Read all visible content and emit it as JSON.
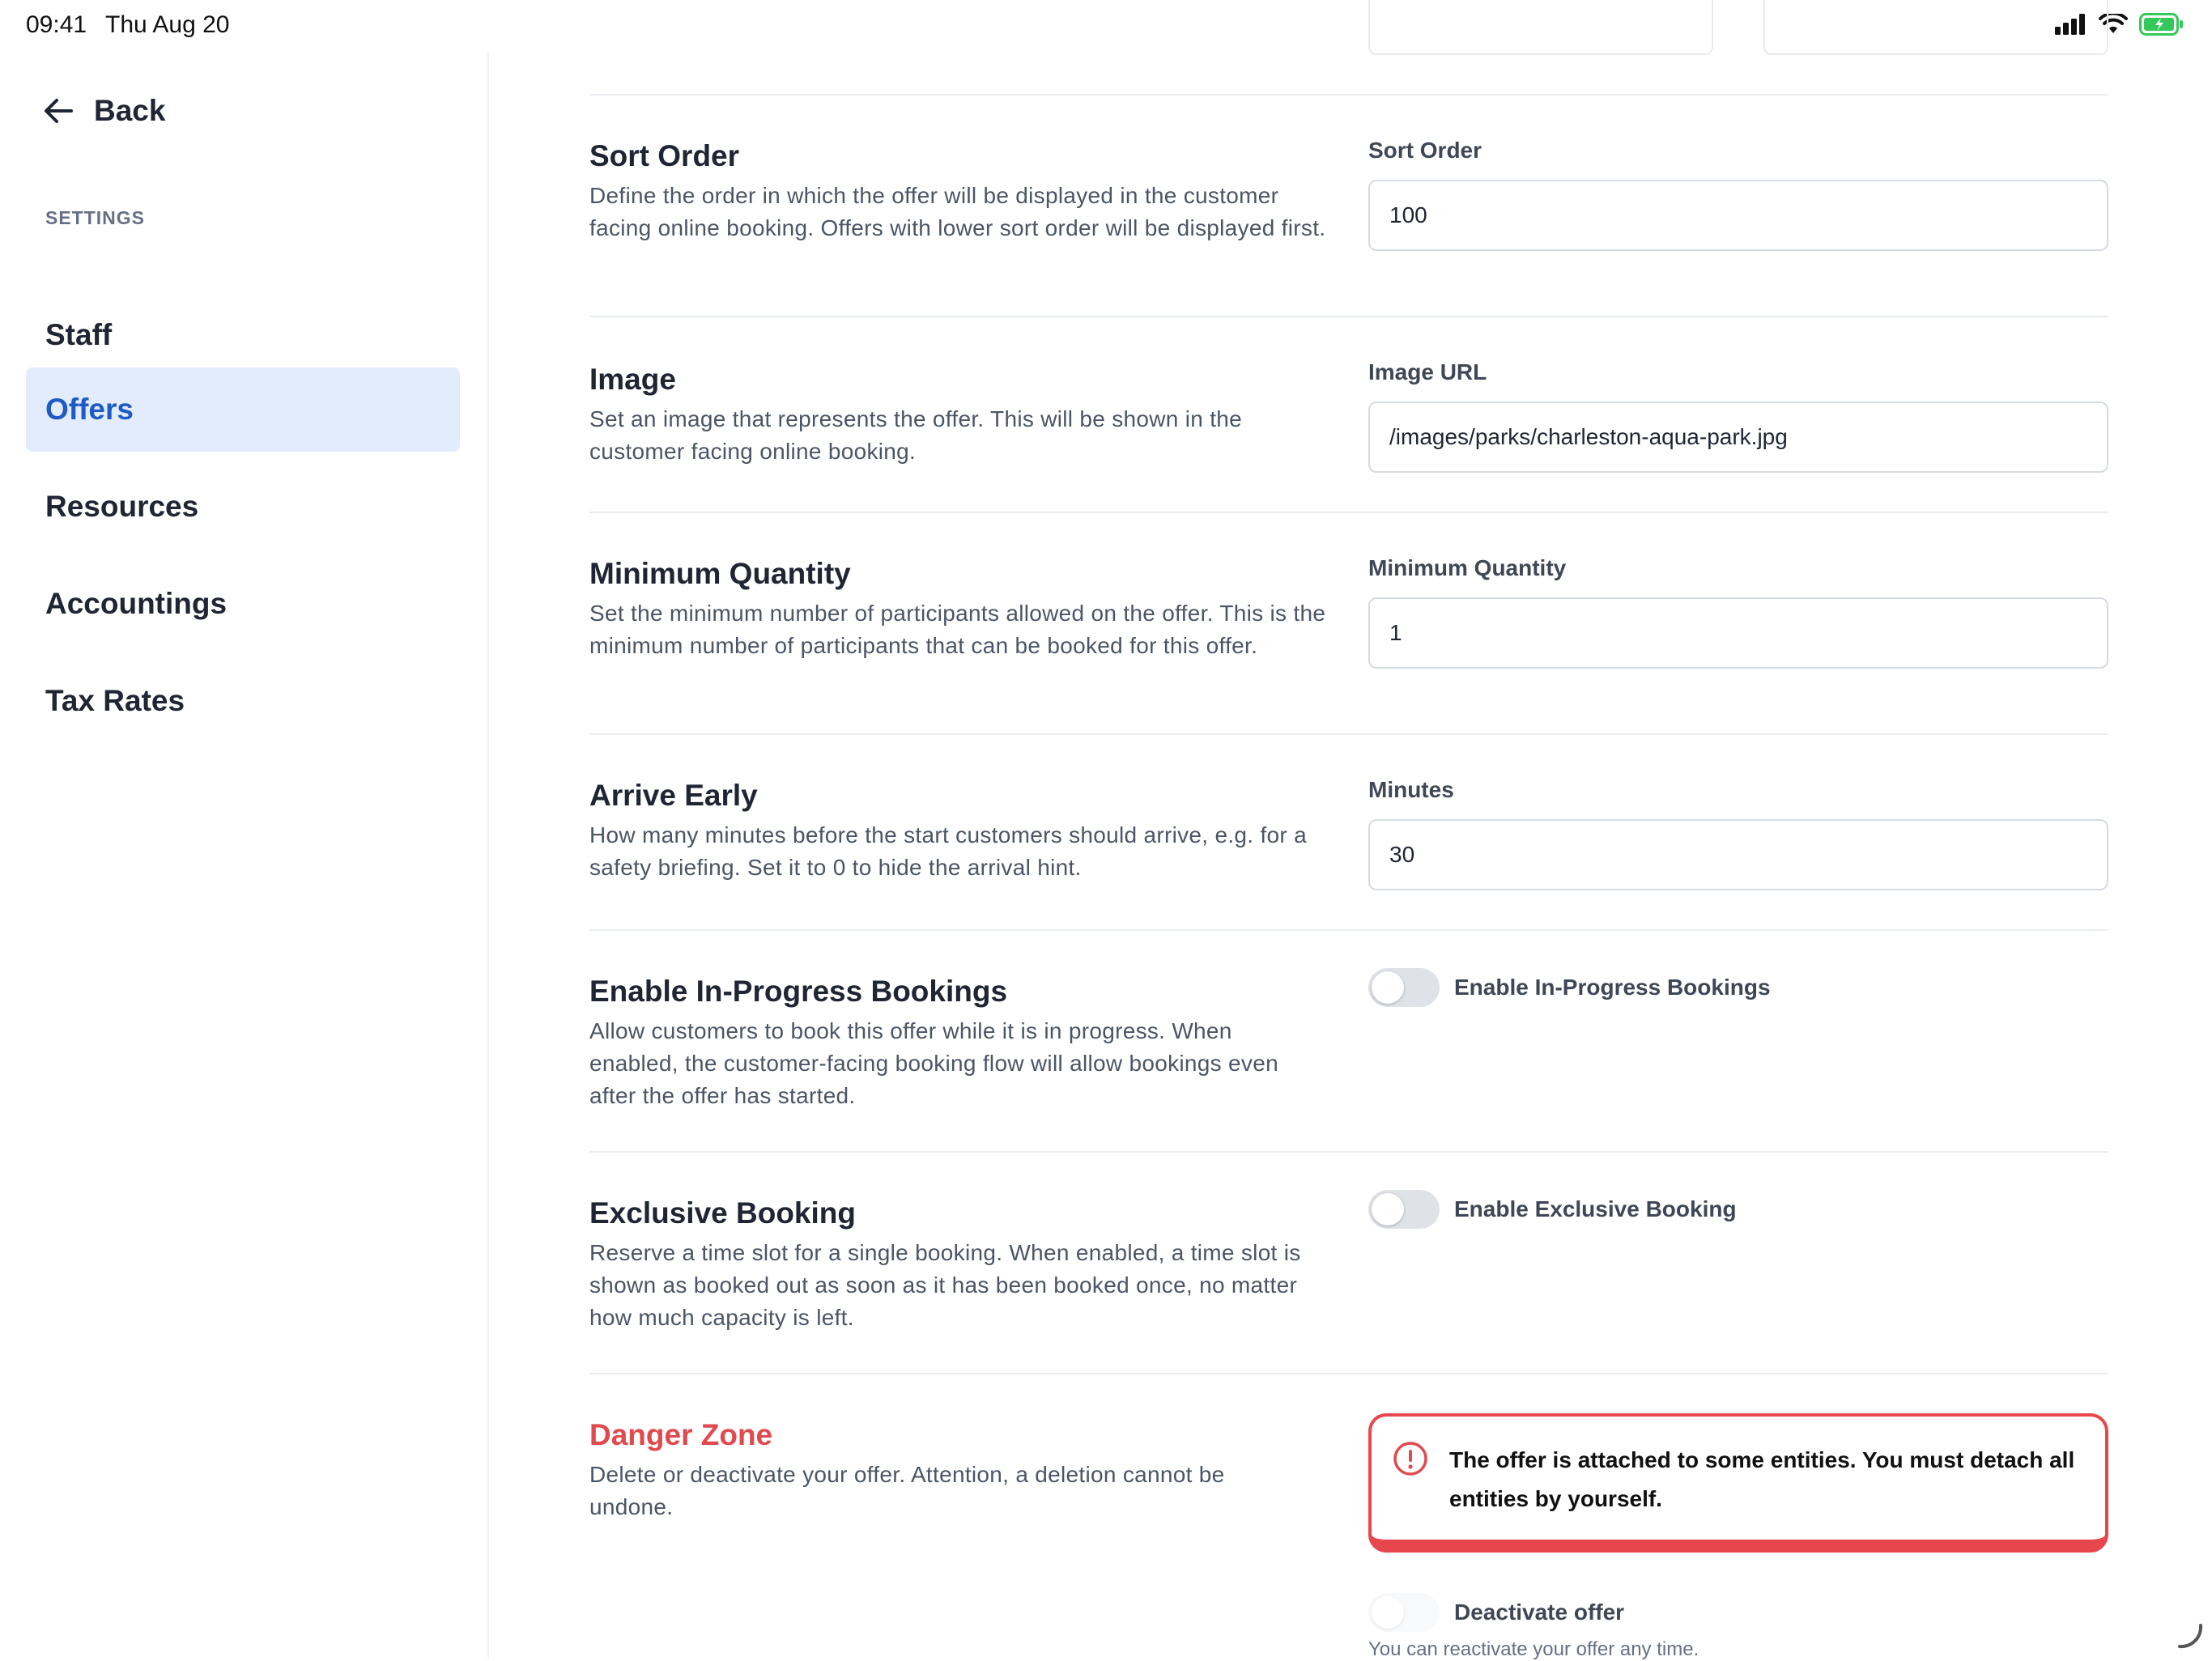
{
  "status_bar": {
    "time": "09:41",
    "date": "Thu Aug 20"
  },
  "sidebar": {
    "back_label": "Back",
    "section_label": "SETTINGS",
    "items": [
      {
        "label": "Staff",
        "active": false
      },
      {
        "label": "Offers",
        "active": true
      },
      {
        "label": "Resources",
        "active": false
      },
      {
        "label": "Accountings",
        "active": false
      },
      {
        "label": "Tax Rates",
        "active": false
      }
    ]
  },
  "sections": {
    "sort_order": {
      "title": "Sort Order",
      "description": "Define the order in which the offer will be displayed in the customer facing online booking. Offers with lower sort order will be displayed first.",
      "field_label": "Sort Order",
      "value": "100"
    },
    "image": {
      "title": "Image",
      "description": "Set an image that represents the offer. This will be shown in the customer facing online booking.",
      "field_label": "Image URL",
      "value": "/images/parks/charleston-aqua-park.jpg"
    },
    "minimum_quantity": {
      "title": "Minimum Quantity",
      "description": "Set the minimum number of participants allowed on the offer. This is the minimum number of participants that can be booked for this offer.",
      "field_label": "Minimum Quantity",
      "value": "1"
    },
    "arrive_early": {
      "title": "Arrive Early",
      "description": "How many minutes before the start customers should arrive, e.g. for a safety briefing. Set it to 0 to hide the arrival hint.",
      "field_label": "Minutes",
      "value": "30"
    },
    "in_progress": {
      "title": "Enable In-Progress Bookings",
      "description": "Allow customers to book this offer while it is in progress. When enabled, the customer-facing booking flow will allow bookings even after the offer has started.",
      "toggle_label": "Enable In-Progress Bookings",
      "enabled": false
    },
    "exclusive": {
      "title": "Exclusive Booking",
      "description": "Reserve a time slot for a single booking. When enabled, a time slot is shown as booked out as soon as it has been booked once, no matter how much capacity is left.",
      "toggle_label": "Enable Exclusive Booking",
      "enabled": false
    },
    "danger_zone": {
      "title": "Danger Zone",
      "description": "Delete or deactivate your offer. Attention, a deletion cannot be undone.",
      "alert_text": "The offer is attached to some entities. You must detach all entities by yourself.",
      "deactivate_label": "Deactivate offer",
      "deactivate_hint": "You can reactivate your offer any time."
    }
  },
  "colors": {
    "accent": "#1f5bc4",
    "active_bg": "#e2ecfd",
    "danger": "#e04a4f",
    "battery": "#34c759"
  }
}
